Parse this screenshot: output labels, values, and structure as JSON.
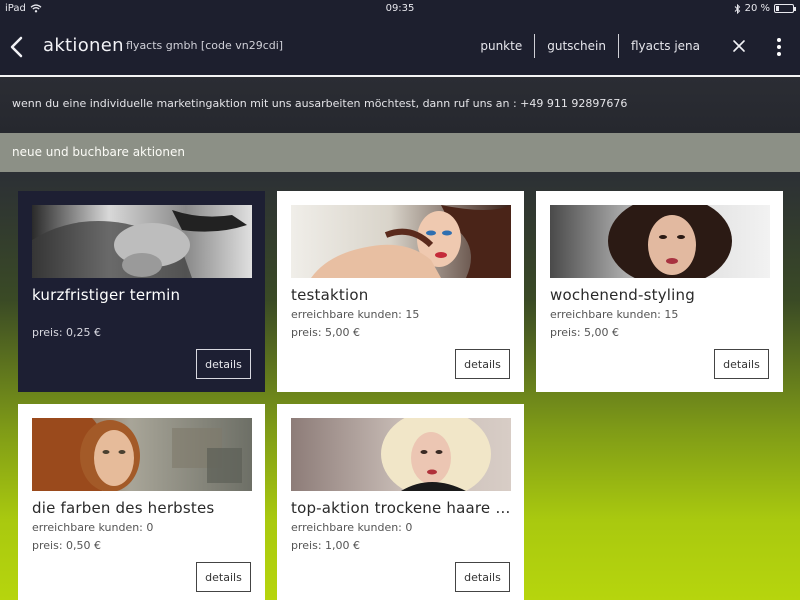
{
  "status_bar": {
    "device": "iPad",
    "time": "09:35",
    "battery": "20 %",
    "battery_level": 0.2
  },
  "header": {
    "title": "aktionen",
    "subtitle": "flyacts gmbh [code vn29cdi]",
    "nav": [
      "punkte",
      "gutschein",
      "flyacts jena"
    ]
  },
  "info_text": "wenn du eine individuelle marketingaktion mit uns ausarbeiten möchtest, dann ruf uns an : +49 911 92897676",
  "section_title": "neue und buchbare aktionen",
  "cards": [
    {
      "title": "kurzfristiger termin",
      "customers_label": "",
      "customers": "",
      "price_label": "preis:",
      "price": "0,25 €",
      "button": "details",
      "photo": "hair-wash-photo"
    },
    {
      "title": "testaktion",
      "customers_label": "erreichbare kunden:",
      "customers": "15",
      "price_label": "preis:",
      "price": "5,00 €",
      "button": "details",
      "photo": "hair-model-photo"
    },
    {
      "title": "wochenend-styling",
      "customers_label": "erreichbare kunden:",
      "customers": "15",
      "price_label": "preis:",
      "price": "5,00 €",
      "button": "details",
      "photo": "curly-hair-photo"
    },
    {
      "title": "die farben des herbstes",
      "customers_label": "erreichbare kunden:",
      "customers": "0",
      "price_label": "preis:",
      "price": "0,50 €",
      "button": "details",
      "photo": "red-hair-photo"
    },
    {
      "title": "top-aktion trockene haare im...",
      "customers_label": "erreichbare kunden:",
      "customers": "0",
      "price_label": "preis:",
      "price": "1,00 €",
      "button": "details",
      "photo": "blonde-curls-photo"
    }
  ],
  "colors": {
    "header_bg": "#1d1f2e",
    "active_card_bg": "#1d1f33",
    "section_bar": "#8c9086",
    "gradient_bottom": "#b6d50d"
  }
}
